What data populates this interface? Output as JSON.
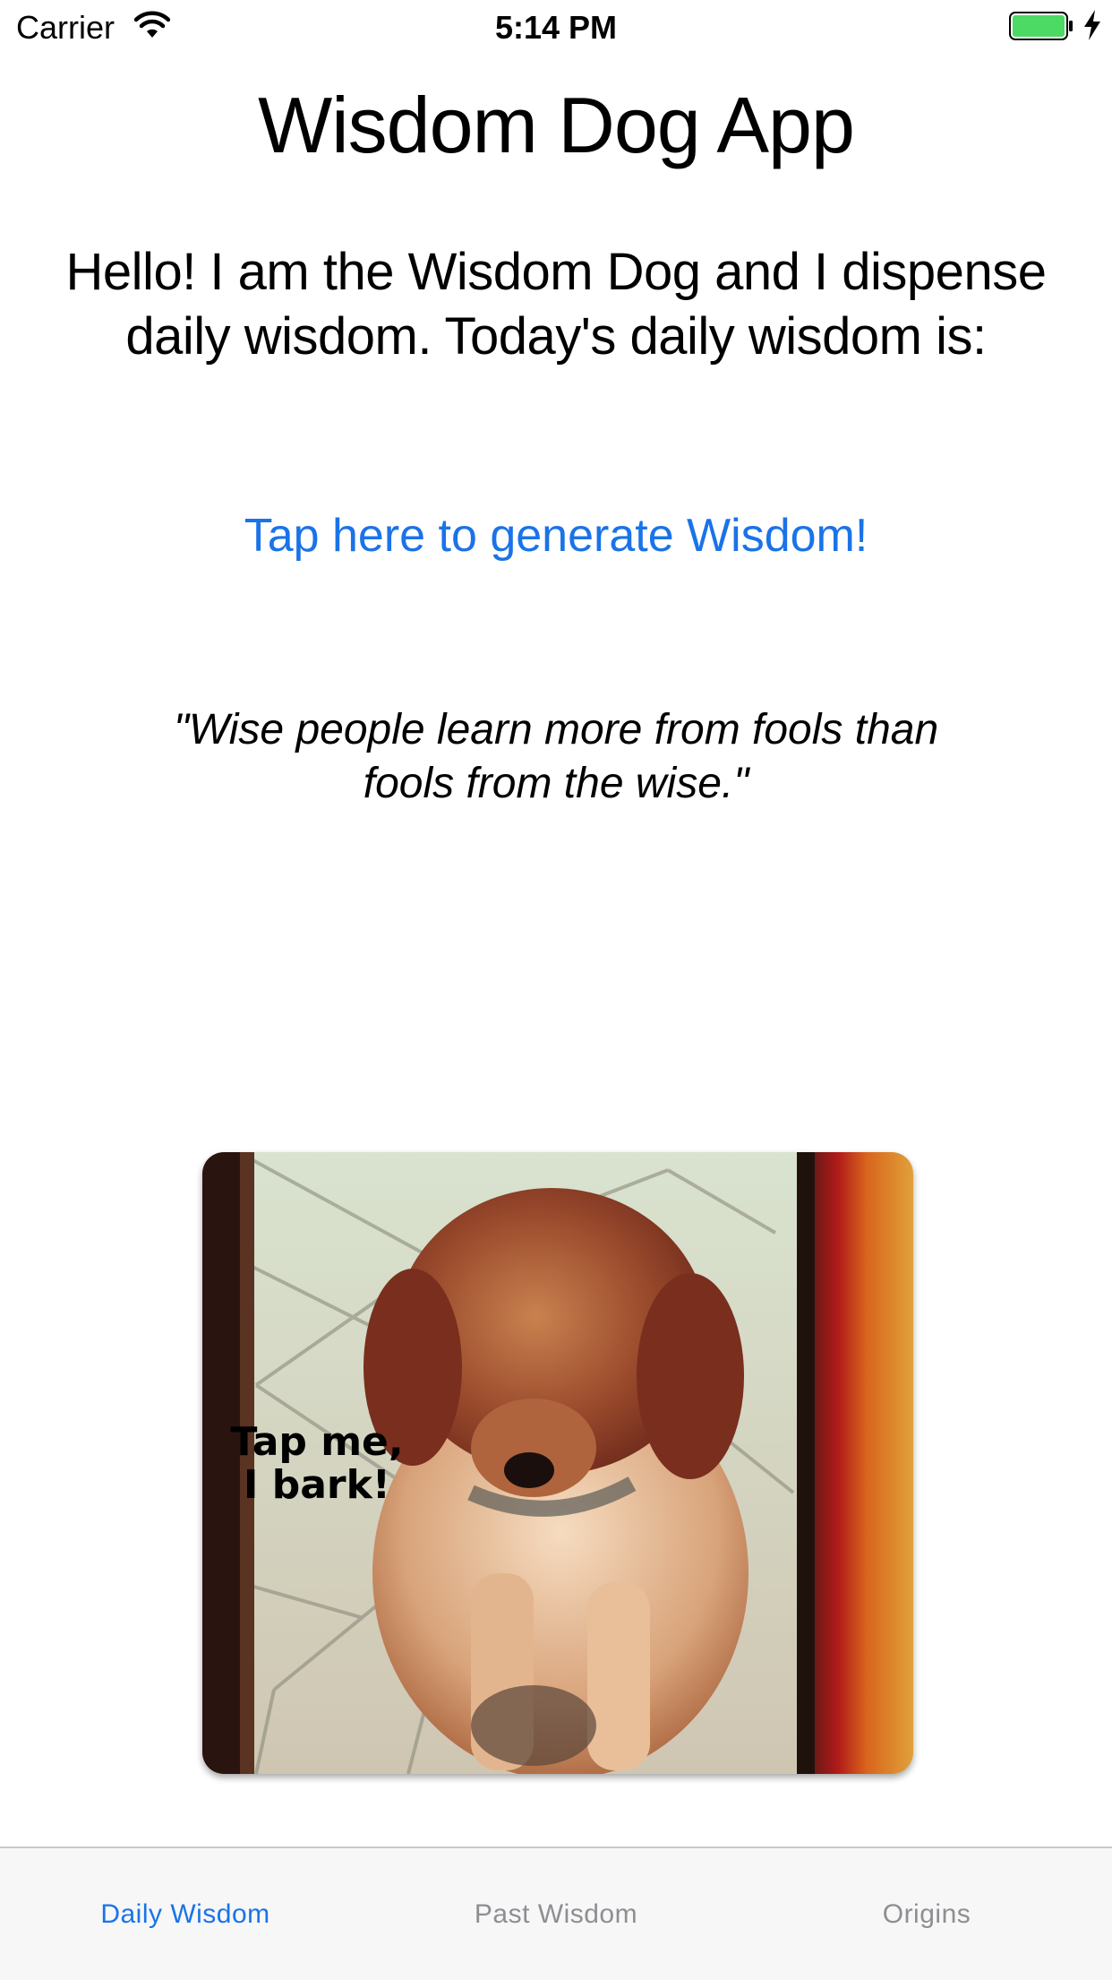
{
  "status_bar": {
    "carrier": "Carrier",
    "time": "5:14 PM",
    "battery_color": "#4cd964"
  },
  "main": {
    "title": "Wisdom Dog App",
    "intro": "Hello! I am the Wisdom Dog and I dispense daily wisdom. Today's daily wisdom is:",
    "generate_label": "Tap here to generate Wisdom!",
    "quote": "\"Wise people learn more from fools than fools from the wise.\"",
    "photo_caption": "Tap me, I bark!"
  },
  "tabs": [
    {
      "label": "Daily Wisdom",
      "active": true
    },
    {
      "label": "Past Wisdom",
      "active": false
    },
    {
      "label": "Origins",
      "active": false
    }
  ],
  "colors": {
    "accent": "#1a73e8",
    "inactive_tab": "#8e8e93",
    "tab_bar_bg": "#f7f7f7"
  }
}
